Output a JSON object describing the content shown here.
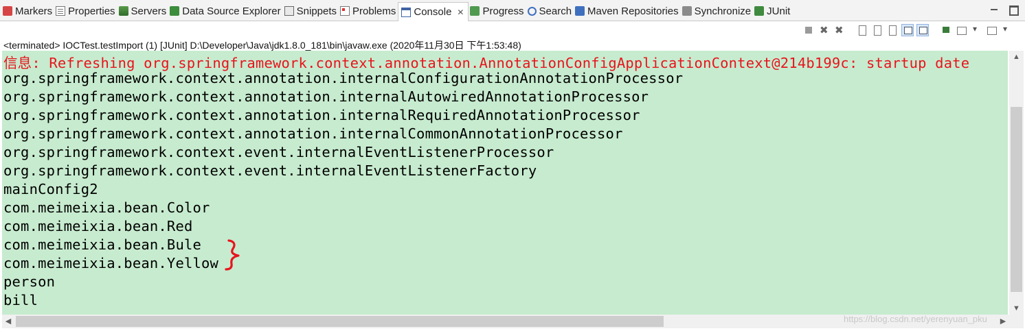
{
  "tabs": [
    {
      "label": "Markers",
      "icon": "markers-icon"
    },
    {
      "label": "Properties",
      "icon": "properties-icon"
    },
    {
      "label": "Servers",
      "icon": "servers-icon"
    },
    {
      "label": "Data Source Explorer",
      "icon": "data-source-explorer-icon"
    },
    {
      "label": "Snippets",
      "icon": "snippets-icon"
    },
    {
      "label": "Problems",
      "icon": "problems-icon"
    },
    {
      "label": "Console",
      "icon": "console-icon",
      "close": "✕",
      "active": true
    },
    {
      "label": "Progress",
      "icon": "progress-icon"
    },
    {
      "label": "Search",
      "icon": "search-icon"
    },
    {
      "label": "Maven Repositories",
      "icon": "maven-repositories-icon"
    },
    {
      "label": "Synchronize",
      "icon": "synchronize-icon"
    },
    {
      "label": "JUnit",
      "icon": "junit-icon"
    }
  ],
  "status": "<terminated> IOCTest.testImport (1) [JUnit] D:\\Developer\\Java\\jdk1.8.0_181\\bin\\javaw.exe (2020年11月30日 下午1:53:48)",
  "console_lines": [
    {
      "text": "信息: Refreshing org.springframework.context.annotation.AnnotationConfigApplicationContext@214b199c: startup date",
      "error": true
    },
    {
      "text": "org.springframework.context.annotation.internalConfigurationAnnotationProcessor",
      "error": false
    },
    {
      "text": "org.springframework.context.annotation.internalAutowiredAnnotationProcessor",
      "error": false
    },
    {
      "text": "org.springframework.context.annotation.internalRequiredAnnotationProcessor",
      "error": false
    },
    {
      "text": "org.springframework.context.annotation.internalCommonAnnotationProcessor",
      "error": false
    },
    {
      "text": "org.springframework.context.event.internalEventListenerProcessor",
      "error": false
    },
    {
      "text": "org.springframework.context.event.internalEventListenerFactory",
      "error": false
    },
    {
      "text": "mainConfig2",
      "error": false
    },
    {
      "text": "com.meimeixia.bean.Color",
      "error": false
    },
    {
      "text": "com.meimeixia.bean.Red",
      "error": false
    },
    {
      "text": "com.meimeixia.bean.Bule",
      "error": false
    },
    {
      "text": "com.meimeixia.bean.Yellow",
      "error": false
    },
    {
      "text": "person",
      "error": false
    },
    {
      "text": "bill",
      "error": false
    }
  ],
  "watermark": "https://blog.csdn.net/yerenyuan_pku",
  "colors": {
    "console_bg": "#c7ebcf",
    "error_text": "#e8141d",
    "annotation": "#e8141d"
  }
}
